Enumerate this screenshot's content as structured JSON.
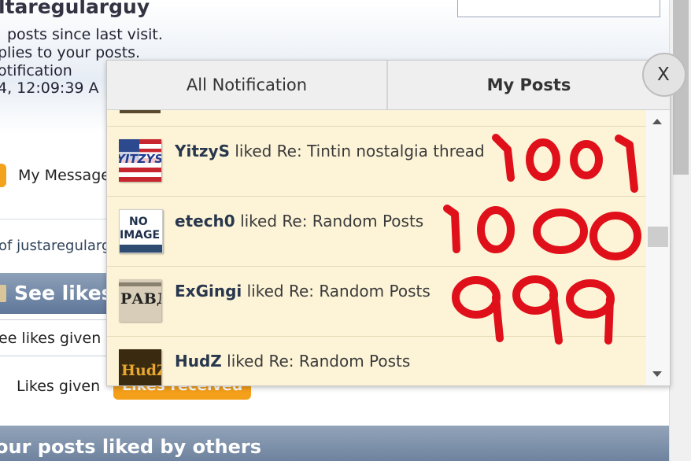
{
  "background_page": {
    "username": "ltaregularguy",
    "line1": "posts since last visit.",
    "line2": "plies to your posts.",
    "line3": "otification",
    "line4": "4, 12:09:39 A",
    "my_messages": "My Message",
    "of_user": "of justaregularg",
    "see_likes": "See likes",
    "see_likes_given": "ee likes given",
    "likes_given": "Likes given",
    "likes_received": "Likes received",
    "bottom_heading": "our posts liked by others"
  },
  "popup": {
    "tabs": [
      {
        "label": "All Notification",
        "active": false
      },
      {
        "label": "My Posts",
        "active": true
      }
    ],
    "close_label": "X",
    "notifications": [
      {
        "user": "YitzyS",
        "action": "liked Re: Tintin nostalgia thread",
        "avatar_text": "YITZYS",
        "avatar": "us-flag-avatar"
      },
      {
        "user": "etech0",
        "action": "liked Re: Random Posts",
        "avatar_text_1": "NO",
        "avatar_text_2": "IMAGE",
        "avatar": "no-image-avatar"
      },
      {
        "user": "ExGingi",
        "action": "liked Re: Random Posts",
        "avatar_text": "РАВД",
        "avatar": "newspaper-avatar"
      },
      {
        "user": "HudZ",
        "action": "liked Re: Random Posts",
        "avatar_text": "HudZ",
        "avatar": "hudz-avatar"
      }
    ]
  },
  "annotations": [
    "1001",
    "1000",
    "999"
  ],
  "colors": {
    "popup_background": "#fdf4d8",
    "annotation_red": "#e0101a",
    "accent_orange": "#f5a01a",
    "header_blue": "#6a7f9c"
  }
}
